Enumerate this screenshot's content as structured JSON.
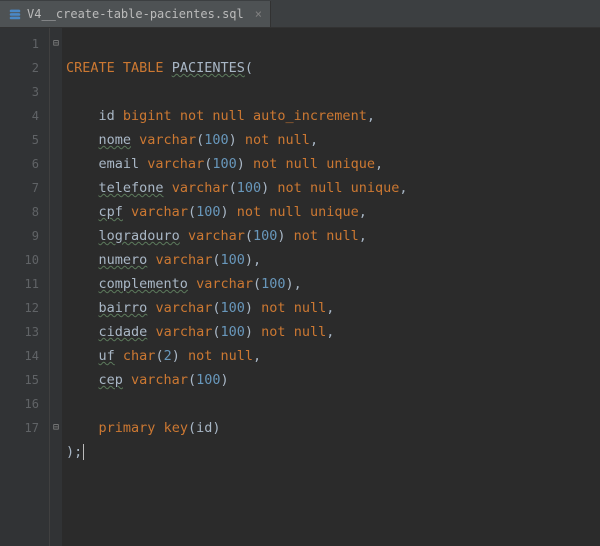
{
  "tab": {
    "filename": "V4__create-table-pacientes.sql",
    "close": "×"
  },
  "gutter": [
    "1",
    "2",
    "3",
    "4",
    "5",
    "6",
    "7",
    "8",
    "9",
    "10",
    "11",
    "12",
    "13",
    "14",
    "15",
    "16",
    "17"
  ],
  "fold": {
    "open": "⊟",
    "close": "⊟"
  },
  "code": {
    "l1": {
      "kw1": "CREATE",
      "kw2": "TABLE",
      "name": "PACIENTES",
      "open": "("
    },
    "l3": {
      "col": "id",
      "type": "bigint",
      "nn1": "not",
      "nn2": "null",
      "auto": "auto_increment",
      "c": ","
    },
    "l4": {
      "col": "nome",
      "type": "varchar",
      "po": "(",
      "n": "100",
      "pc": ")",
      "nn1": "not",
      "nn2": "null",
      "c": ","
    },
    "l5": {
      "col": "email",
      "type": "varchar",
      "po": "(",
      "n": "100",
      "pc": ")",
      "nn1": "not",
      "nn2": "null",
      "u": "unique",
      "c": ","
    },
    "l6": {
      "col": "telefone",
      "type": "varchar",
      "po": "(",
      "n": "100",
      "pc": ")",
      "nn1": "not",
      "nn2": "null",
      "u": "unique",
      "c": ","
    },
    "l7": {
      "col": "cpf",
      "type": "varchar",
      "po": "(",
      "n": "100",
      "pc": ")",
      "nn1": "not",
      "nn2": "null",
      "u": "unique",
      "c": ","
    },
    "l8": {
      "col": "logradouro",
      "type": "varchar",
      "po": "(",
      "n": "100",
      "pc": ")",
      "nn1": "not",
      "nn2": "null",
      "c": ","
    },
    "l9": {
      "col": "numero",
      "type": "varchar",
      "po": "(",
      "n": "100",
      "pc": ")",
      "c": ","
    },
    "l10": {
      "col": "complemento",
      "type": "varchar",
      "po": "(",
      "n": "100",
      "pc": ")",
      "c": ","
    },
    "l11": {
      "col": "bairro",
      "type": "varchar",
      "po": "(",
      "n": "100",
      "pc": ")",
      "nn1": "not",
      "nn2": "null",
      "c": ","
    },
    "l12": {
      "col": "cidade",
      "type": "varchar",
      "po": "(",
      "n": "100",
      "pc": ")",
      "nn1": "not",
      "nn2": "null",
      "c": ","
    },
    "l13": {
      "col": "uf",
      "type": "char",
      "po": "(",
      "n": "2",
      "pc": ")",
      "nn1": "not",
      "nn2": "null",
      "c": ","
    },
    "l14": {
      "col": "cep",
      "type": "varchar",
      "po": "(",
      "n": "100",
      "pc": ")"
    },
    "l16": {
      "pk1": "primary",
      "pk2": "key",
      "po": "(",
      "id": "id",
      "pc": ")"
    },
    "l17": {
      "close": ");"
    }
  }
}
